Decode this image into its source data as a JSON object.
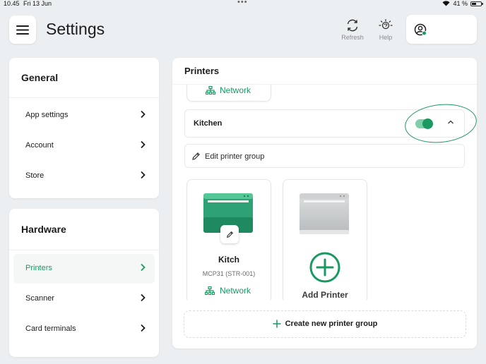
{
  "status_bar": {
    "time": "10.45",
    "date": "Fri 13 Jun",
    "battery": "41 %"
  },
  "header": {
    "title": "Settings",
    "refresh_label": "Refresh",
    "help_label": "Help"
  },
  "sidebar": {
    "general": {
      "heading": "General",
      "items": [
        {
          "label": "App settings"
        },
        {
          "label": "Account"
        },
        {
          "label": "Store"
        }
      ]
    },
    "hardware": {
      "heading": "Hardware",
      "items": [
        {
          "label": "Printers",
          "active": true
        },
        {
          "label": "Scanner"
        },
        {
          "label": "Card terminals"
        }
      ]
    }
  },
  "main": {
    "title": "Printers",
    "partial_printer_network": "Network",
    "group": {
      "name": "Kitchen",
      "enabled": true
    },
    "edit_group_label": "Edit printer group",
    "printers": [
      {
        "name": "Kitch",
        "model": "MCP31 (STR-001)",
        "connection": "Network"
      }
    ],
    "add_printer_label": "Add Printer",
    "create_group_label": "Create new printer group"
  },
  "colors": {
    "accent": "#1a9a62",
    "background": "#eceff1",
    "card": "#ffffff"
  },
  "icons": [
    "menu-icon",
    "refresh-icon",
    "help-icon",
    "profile-icon",
    "chevron-right-icon",
    "network-icon",
    "chevron-up-icon",
    "pencil-icon",
    "plus-circle-icon",
    "plus-icon",
    "printer-icon"
  ]
}
